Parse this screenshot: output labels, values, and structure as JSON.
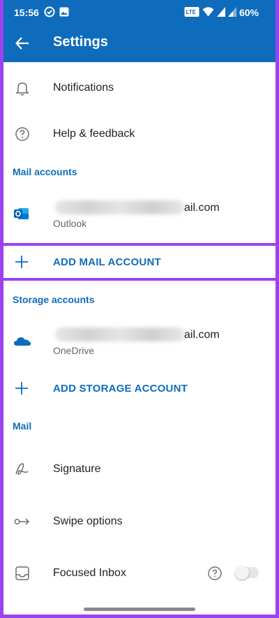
{
  "status_bar": {
    "time": "15:56",
    "battery": "60%"
  },
  "app_bar": {
    "title": "Settings"
  },
  "general": [
    {
      "label": "Notifications",
      "icon": "bell-icon"
    },
    {
      "label": "Help & feedback",
      "icon": "help-icon"
    }
  ],
  "mail_accounts": {
    "heading": "Mail accounts",
    "account": {
      "email_suffix": "ail.com",
      "provider": "Outlook",
      "icon": "outlook-icon"
    },
    "add_label": "ADD MAIL ACCOUNT"
  },
  "storage_accounts": {
    "heading": "Storage accounts",
    "account": {
      "email_suffix": "ail.com",
      "provider": "OneDrive",
      "icon": "onedrive-icon"
    },
    "add_label": "ADD STORAGE ACCOUNT"
  },
  "mail": {
    "heading": "Mail",
    "items": [
      {
        "label": "Signature",
        "icon": "signature-icon"
      },
      {
        "label": "Swipe options",
        "icon": "swipe-icon"
      },
      {
        "label": "Focused Inbox",
        "icon": "inbox-icon",
        "toggle_on": false
      }
    ]
  },
  "colors": {
    "accent": "#0f6cbd",
    "highlight_border": "#9b42f0"
  }
}
